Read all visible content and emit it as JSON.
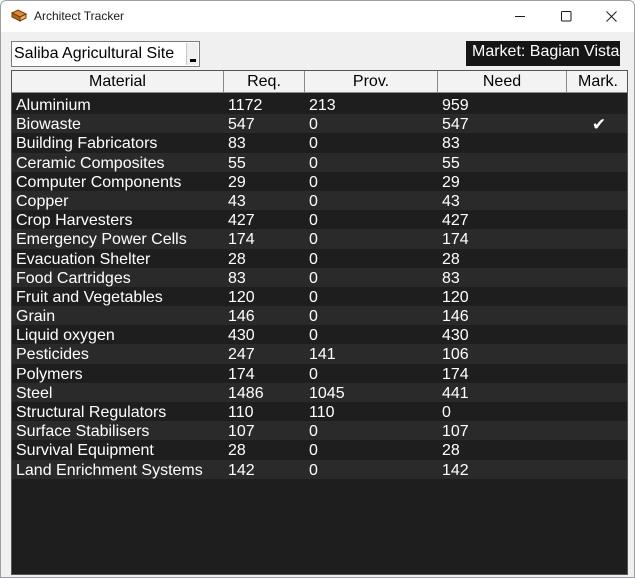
{
  "window": {
    "title": "Architect Tracker",
    "icon": "architect-tracker-logo-icon",
    "controls": [
      "minimize-icon",
      "maximize-icon",
      "close-icon"
    ]
  },
  "site_selector": {
    "value": "Saliba Agricultural Site",
    "icon": "dropdown-arrow-icon"
  },
  "market": {
    "label": "Market: Bagian Vista"
  },
  "table": {
    "headers": {
      "material": "Material",
      "req": "Req.",
      "prov": "Prov.",
      "need": "Need",
      "mark": "Mark."
    },
    "rows": [
      {
        "material": "Aluminium",
        "req": "1172",
        "prov": "213",
        "need": "959",
        "mark": ""
      },
      {
        "material": "Biowaste",
        "req": "547",
        "prov": "0",
        "need": "547",
        "mark": "✔"
      },
      {
        "material": "Building Fabricators",
        "req": "83",
        "prov": "0",
        "need": "83",
        "mark": ""
      },
      {
        "material": "Ceramic Composites",
        "req": "55",
        "prov": "0",
        "need": "55",
        "mark": ""
      },
      {
        "material": "Computer Components",
        "req": "29",
        "prov": "0",
        "need": "29",
        "mark": ""
      },
      {
        "material": "Copper",
        "req": "43",
        "prov": "0",
        "need": "43",
        "mark": ""
      },
      {
        "material": "Crop Harvesters",
        "req": "427",
        "prov": "0",
        "need": "427",
        "mark": ""
      },
      {
        "material": "Emergency Power Cells",
        "req": "174",
        "prov": "0",
        "need": "174",
        "mark": ""
      },
      {
        "material": "Evacuation Shelter",
        "req": "28",
        "prov": "0",
        "need": "28",
        "mark": ""
      },
      {
        "material": "Food Cartridges",
        "req": "83",
        "prov": "0",
        "need": "83",
        "mark": ""
      },
      {
        "material": "Fruit and Vegetables",
        "req": "120",
        "prov": "0",
        "need": "120",
        "mark": ""
      },
      {
        "material": "Grain",
        "req": "146",
        "prov": "0",
        "need": "146",
        "mark": ""
      },
      {
        "material": "Liquid oxygen",
        "req": "430",
        "prov": "0",
        "need": "430",
        "mark": ""
      },
      {
        "material": "Pesticides",
        "req": "247",
        "prov": "141",
        "need": "106",
        "mark": ""
      },
      {
        "material": "Polymers",
        "req": "174",
        "prov": "0",
        "need": "174",
        "mark": ""
      },
      {
        "material": "Steel",
        "req": "1486",
        "prov": "1045",
        "need": "441",
        "mark": ""
      },
      {
        "material": "Structural Regulators",
        "req": "110",
        "prov": "110",
        "need": "0",
        "mark": ""
      },
      {
        "material": "Surface Stabilisers",
        "req": "107",
        "prov": "0",
        "need": "107",
        "mark": ""
      },
      {
        "material": "Survival Equipment",
        "req": "28",
        "prov": "0",
        "need": "28",
        "mark": ""
      },
      {
        "material": "Land Enrichment Systems",
        "req": "142",
        "prov": "0",
        "need": "142",
        "mark": ""
      }
    ]
  },
  "colors": {
    "table_background": "#1e1e1e",
    "alt_row": "#2a2a2a",
    "text": "#ffffff",
    "market_background": "#161616"
  }
}
